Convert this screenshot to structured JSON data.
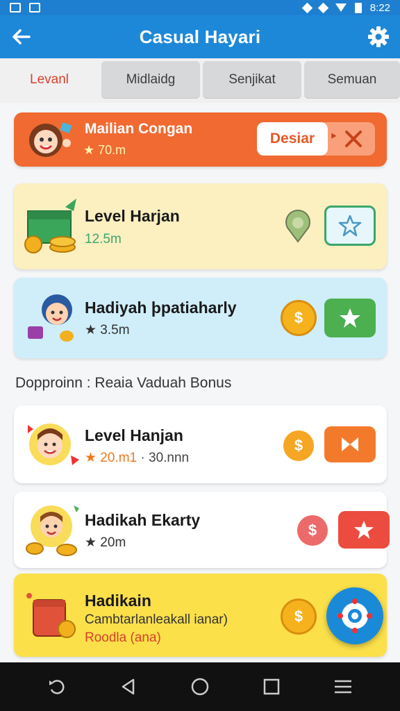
{
  "statusbar": {
    "time": "8:22"
  },
  "appbar": {
    "title": "Casual Hayari"
  },
  "tabs": [
    {
      "label": "Levanl"
    },
    {
      "label": "Midlaidg"
    },
    {
      "label": "Senjikat"
    },
    {
      "label": "Semuan"
    }
  ],
  "banner": {
    "title": "Mailian Congan",
    "subtitle": "★ 70.m",
    "action_label": "Desiar",
    "action_arrow": "‣"
  },
  "cards": [
    {
      "title": "Level Harjan",
      "subtitle": "12.5m"
    },
    {
      "title": "Hadiyah þpatiaharly",
      "subtitle": "★ 3.5m"
    }
  ],
  "section": {
    "label": "Dopproinn : Reaia Vaduah Bonus"
  },
  "bonus_cards": [
    {
      "title": "Level Hanjan",
      "subtitle_highlight": "★ 20.m1",
      "subtitle_rest": " · 30.nnn"
    },
    {
      "title": "Hadikah Ekarty",
      "subtitle": "★ 20m"
    },
    {
      "title": "Hadikain",
      "line2": "Cambtarlanleakall ianar)",
      "line3": "Roodla (ana)"
    }
  ],
  "colors": {
    "primary": "#1e88d8",
    "banner": "#f06a32",
    "card_yellow": "#fcefc0",
    "card_blue": "#cfeefa",
    "card_gold": "#fbe04a",
    "green": "#4caf50",
    "orange_btn": "#f47a2b",
    "red_btn": "#ec4b40"
  },
  "icons": [
    "back-arrow-icon",
    "gear-icon",
    "star-icon",
    "close-icon",
    "coin-icon",
    "pin-icon",
    "share-icon",
    "home-icon",
    "recent-icon",
    "menu-icon"
  ]
}
